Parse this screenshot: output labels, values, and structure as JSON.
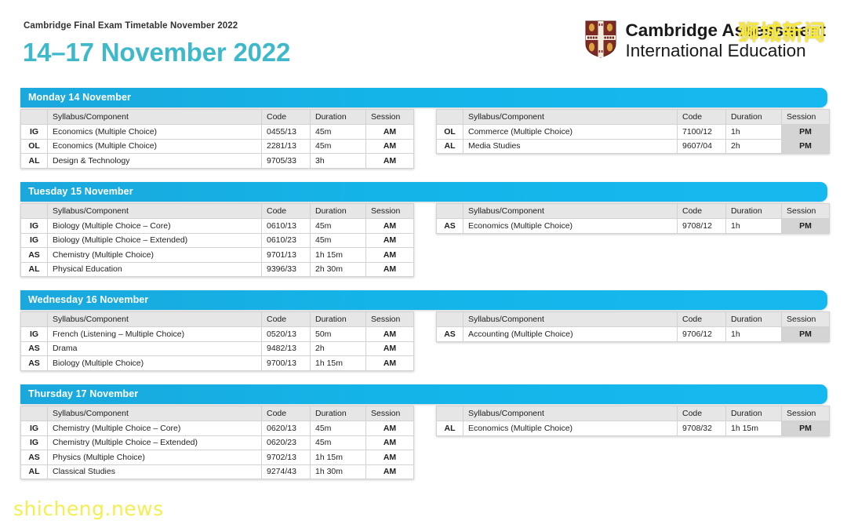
{
  "header": {
    "kicker": "Cambridge Final Exam Timetable November 2022",
    "title": "14–17 November 2022",
    "brand_line1": "Cambridge Assessment",
    "brand_line2": "International Education",
    "crest_icon": "cambridge-crest-icon"
  },
  "colors": {
    "title_teal": "#3fb9c9",
    "day_bar_blue": "#16b9ef",
    "header_row_grey": "#e6e6e6",
    "pm_cell_grey": "#d4d4d4",
    "watermark_yellow": "#f7e93a",
    "page_background": "#ffffff"
  },
  "table_headers": {
    "level": "",
    "syllabus": "Syllabus/Component",
    "code": "Code",
    "duration": "Duration",
    "session": "Session"
  },
  "days": [
    {
      "label": "Monday 14 November",
      "am": [
        {
          "level": "IG",
          "syllabus": "Economics (Multiple Choice)",
          "code": "0455/13",
          "duration": "45m",
          "session": "AM"
        },
        {
          "level": "OL",
          "syllabus": "Economics (Multiple Choice)",
          "code": "2281/13",
          "duration": "45m",
          "session": "AM"
        },
        {
          "level": "AL",
          "syllabus": "Design & Technology",
          "code": "9705/33",
          "duration": "3h",
          "session": "AM"
        }
      ],
      "pm": [
        {
          "level": "OL",
          "syllabus": "Commerce (Multiple Choice)",
          "code": "7100/12",
          "duration": "1h",
          "session": "PM"
        },
        {
          "level": "AL",
          "syllabus": "Media Studies",
          "code": "9607/04",
          "duration": "2h",
          "session": "PM"
        }
      ]
    },
    {
      "label": "Tuesday 15 November",
      "am": [
        {
          "level": "IG",
          "syllabus": "Biology (Multiple Choice – Core)",
          "code": "0610/13",
          "duration": "45m",
          "session": "AM"
        },
        {
          "level": "IG",
          "syllabus": "Biology (Multiple Choice – Extended)",
          "code": "0610/23",
          "duration": "45m",
          "session": "AM"
        },
        {
          "level": "AS",
          "syllabus": "Chemistry (Multiple Choice)",
          "code": "9701/13",
          "duration": "1h 15m",
          "session": "AM"
        },
        {
          "level": "AL",
          "syllabus": "Physical Education",
          "code": "9396/33",
          "duration": "2h 30m",
          "session": "AM"
        }
      ],
      "pm": [
        {
          "level": "AS",
          "syllabus": "Economics (Multiple Choice)",
          "code": "9708/12",
          "duration": "1h",
          "session": "PM"
        }
      ]
    },
    {
      "label": "Wednesday 16 November",
      "am": [
        {
          "level": "IG",
          "syllabus": "French (Listening – Multiple Choice)",
          "code": "0520/13",
          "duration": "50m",
          "session": "AM"
        },
        {
          "level": "AS",
          "syllabus": "Drama",
          "code": "9482/13",
          "duration": "2h",
          "session": "AM"
        },
        {
          "level": "AS",
          "syllabus": "Biology (Multiple Choice)",
          "code": "9700/13",
          "duration": "1h 15m",
          "session": "AM"
        }
      ],
      "pm": [
        {
          "level": "AS",
          "syllabus": "Accounting (Multiple Choice)",
          "code": "9706/12",
          "duration": "1h",
          "session": "PM"
        }
      ]
    },
    {
      "label": "Thursday 17 November",
      "am": [
        {
          "level": "IG",
          "syllabus": "Chemistry (Multiple Choice – Core)",
          "code": "0620/13",
          "duration": "45m",
          "session": "AM"
        },
        {
          "level": "IG",
          "syllabus": "Chemistry (Multiple Choice – Extended)",
          "code": "0620/23",
          "duration": "45m",
          "session": "AM"
        },
        {
          "level": "AS",
          "syllabus": "Physics (Multiple Choice)",
          "code": "9702/13",
          "duration": "1h 15m",
          "session": "AM"
        },
        {
          "level": "AL",
          "syllabus": "Classical Studies",
          "code": "9274/43",
          "duration": "1h 30m",
          "session": "AM"
        }
      ],
      "pm": [
        {
          "level": "AL",
          "syllabus": "Economics (Multiple Choice)",
          "code": "9708/32",
          "duration": "1h 15m",
          "session": "PM"
        }
      ]
    }
  ],
  "watermarks": {
    "top_right": "狮城新闻",
    "bottom_left": "shicheng.news"
  }
}
